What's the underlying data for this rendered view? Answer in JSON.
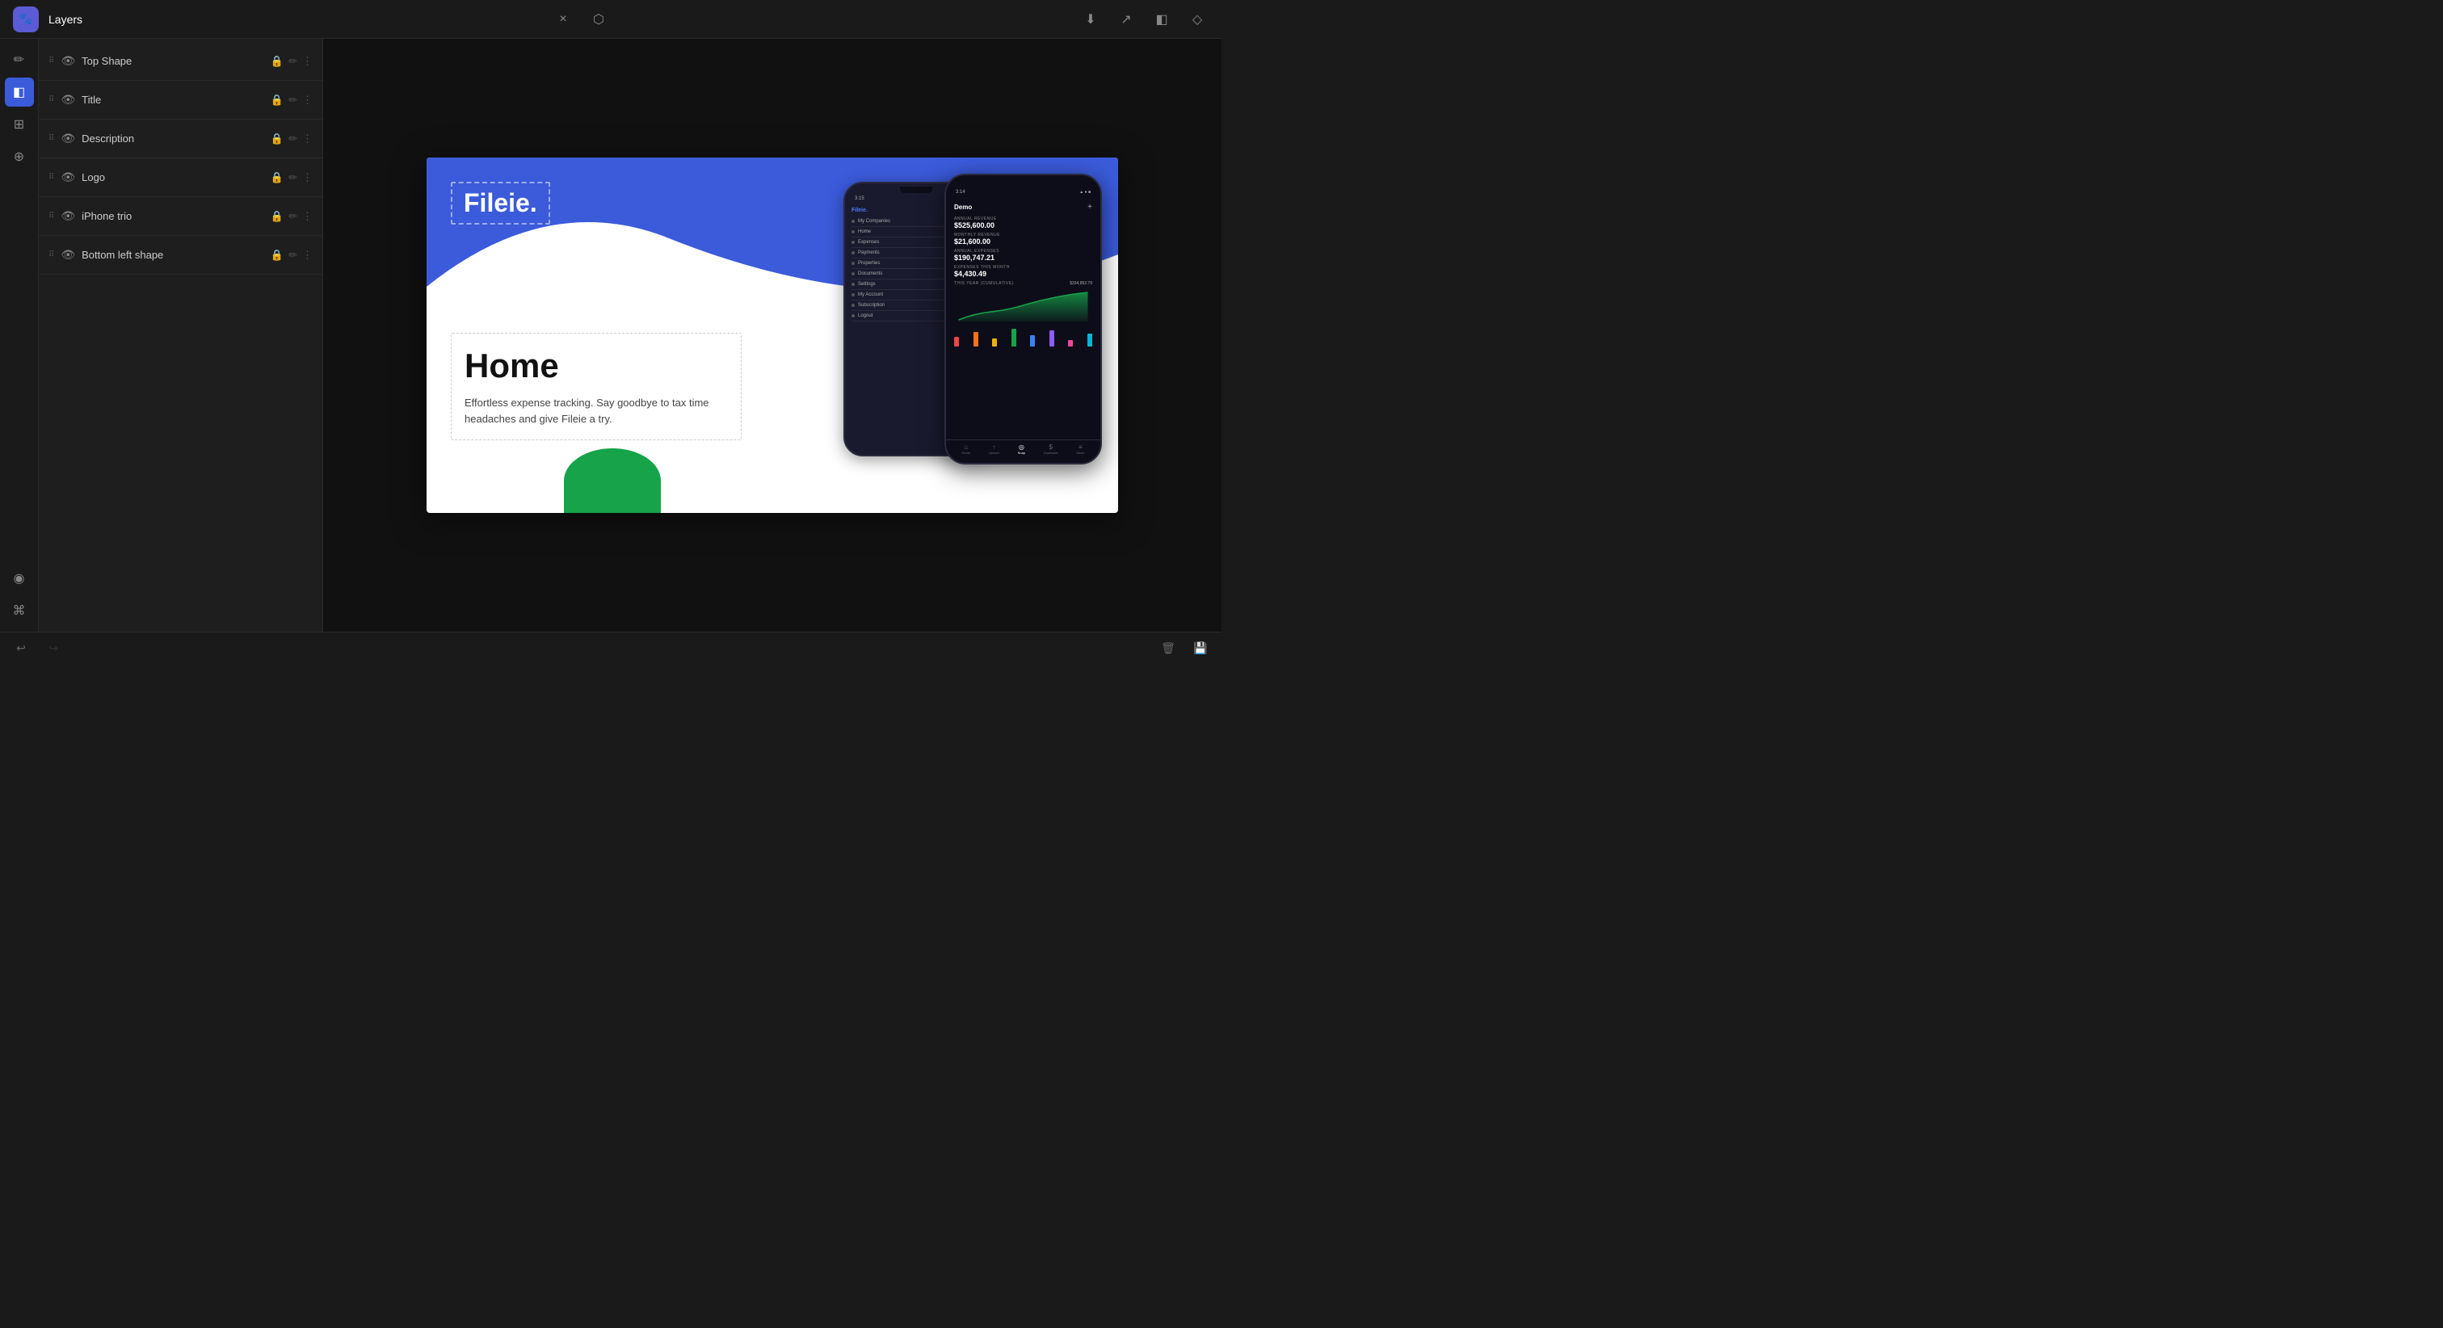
{
  "app": {
    "logo_emoji": "🐾",
    "title": "Layers"
  },
  "toolbar": {
    "close_label": "×",
    "open_label": "⬡",
    "download_icon": "⬇",
    "share_icon": "↗",
    "layers_icon": "◧",
    "diamond_icon": "◇"
  },
  "sidebar": {
    "icons": [
      {
        "name": "edit-icon",
        "emoji": "✏️",
        "active": false
      },
      {
        "name": "layers-icon",
        "emoji": "◧",
        "active": true
      },
      {
        "name": "assets-icon",
        "emoji": "⊞",
        "active": false
      },
      {
        "name": "component-icon",
        "emoji": "⊕",
        "active": false
      },
      {
        "name": "preview-icon",
        "emoji": "◉",
        "active": false
      }
    ]
  },
  "layers": {
    "panel_title": "Layers",
    "items": [
      {
        "id": "top-shape",
        "name": "Top Shape",
        "visible": true,
        "locked": true
      },
      {
        "id": "title",
        "name": "Title",
        "visible": true,
        "locked": true
      },
      {
        "id": "description",
        "name": "Description",
        "visible": true,
        "locked": true
      },
      {
        "id": "logo",
        "name": "Logo",
        "visible": true,
        "locked": true
      },
      {
        "id": "iphone-trio",
        "name": "iPhone trio",
        "visible": true,
        "locked": true
      },
      {
        "id": "bottom-left-shape",
        "name": "Bottom left shape",
        "visible": true,
        "locked": true
      }
    ]
  },
  "preview": {
    "logo_text": "Fileie.",
    "heading": "Home",
    "description": "Effortless expense tracking. Say goodbye to tax time headaches and give Fileie a try.",
    "accent_blue": "#3b5bdb",
    "accent_green": "#16a34a"
  },
  "phone": {
    "back": {
      "status_time": "3:15",
      "app_name": "Fileie.",
      "menu_items": [
        "My Companies",
        "Home",
        "Expenses",
        "Payments",
        "Properties",
        "Documents",
        "Settings",
        "My Account",
        "Subscription",
        "Logout"
      ]
    },
    "front": {
      "status_time": "3:14",
      "header_title": "Demo",
      "annual_revenue_label": "ANNUAL REVENUE",
      "annual_revenue": "$525,600.00",
      "monthly_revenue_label": "MONTHLY REVENUE",
      "monthly_revenue": "$21,600.00",
      "annual_expenses_label": "ANNUAL EXPENSES",
      "annual_expenses": "$190,747.21",
      "expenses_month_label": "EXPENSES THIS MONTH",
      "expenses_month": "$4,430.49",
      "chart_label": "This Year (Cumulative)",
      "chart_value": "$334,852.79",
      "nav_items": [
        "Home",
        "Upload",
        "Snap",
        "Expenses",
        "Menu"
      ]
    }
  },
  "bottom_bar": {
    "undo_label": "↩",
    "redo_label": "↪",
    "delete_label": "🗑",
    "save_label": "💾"
  }
}
